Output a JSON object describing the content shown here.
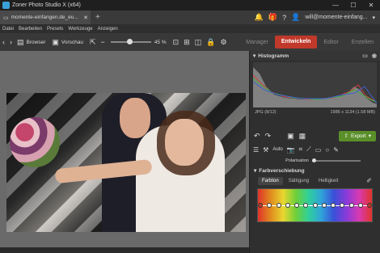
{
  "window": {
    "title": "Zoner Photo Studio X (x64)"
  },
  "tabs": [
    {
      "label": "momente-einfangen.de_eu..."
    }
  ],
  "account": {
    "email": "will@momente-einfang..."
  },
  "menu": [
    "Datei",
    "Bearbeiten",
    "Presets",
    "Werkzeuge",
    "Anzeigen"
  ],
  "toolbar": {
    "browser_label": "Browser",
    "preview_label": "Vorschau",
    "zoom": "45 %"
  },
  "modes": {
    "manager": "Manager",
    "develop": "Entwickeln",
    "editor": "Editor",
    "create": "Erstellen"
  },
  "histogram": {
    "title": "Histogramm"
  },
  "file": {
    "format": "JPG",
    "bit": "(8/12)",
    "dimensions": "1986 x 1134 (1.58 MB)"
  },
  "export": {
    "label": "Export"
  },
  "tools": {
    "auto_label": "Auto"
  },
  "polarisation": {
    "label": "Polarisation",
    "value": 0
  },
  "color_shift": {
    "title": "Farbverschiebung",
    "tabs": [
      "Farbton",
      "Sättigung",
      "Helligkeit"
    ],
    "active_tab": 0,
    "points": 13
  },
  "colors": {
    "accent": "#c0392b",
    "export": "#5a8f29"
  }
}
